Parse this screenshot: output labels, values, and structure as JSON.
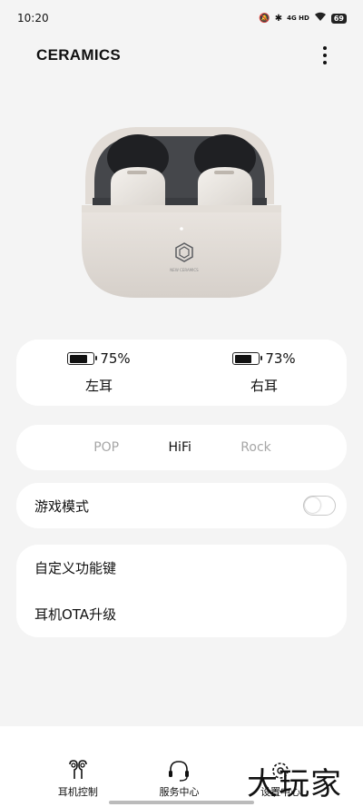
{
  "status_bar": {
    "time": "10:20",
    "network": "4G HD",
    "battery": "69"
  },
  "header": {
    "title": "CERAMICS",
    "more_icon": "more-vertical-icon"
  },
  "case_image": {
    "logo_text": "NEW CERAMICS"
  },
  "battery": {
    "left": {
      "percent": 75,
      "percent_text": "75%",
      "label": "左耳"
    },
    "right": {
      "percent": 73,
      "percent_text": "73%",
      "label": "右耳"
    }
  },
  "eq": {
    "options": [
      "POP",
      "HiFi",
      "Rock"
    ],
    "selected": "HiFi"
  },
  "game_mode": {
    "label": "游戏模式",
    "enabled": false
  },
  "menu": {
    "items": [
      "自定义功能键",
      "耳机OTA升级"
    ]
  },
  "bottom_nav": {
    "items": [
      {
        "label": "耳机控制",
        "icon": "earbuds-icon"
      },
      {
        "label": "服务中心",
        "icon": "headset-icon"
      },
      {
        "label": "设置中心",
        "icon": "settings-icon"
      }
    ]
  },
  "watermark": "大玩家",
  "colors": {
    "background": "#f4f4f4",
    "card": "#ffffff",
    "inactive_text": "#a6a6a6"
  }
}
